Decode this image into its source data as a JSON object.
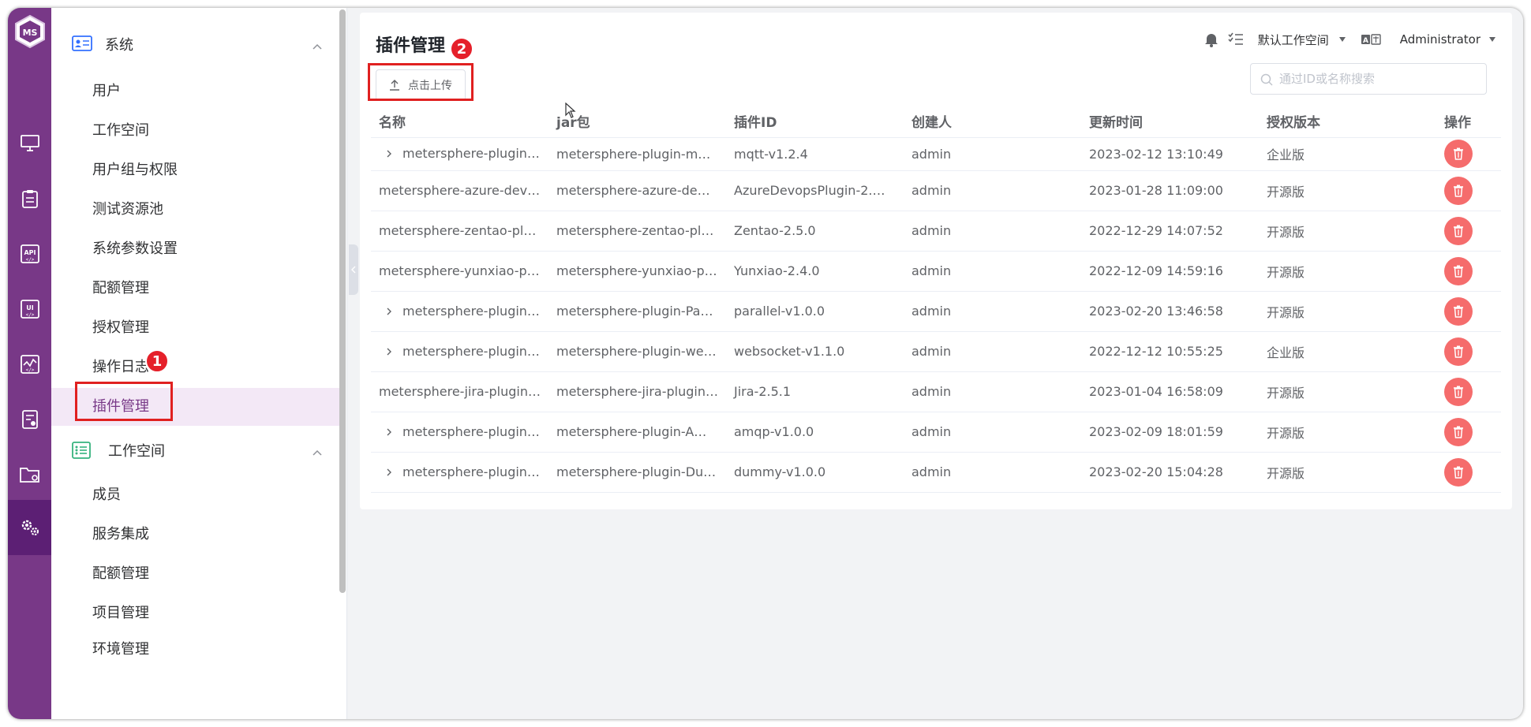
{
  "colors": {
    "brand": "#783887",
    "danger": "#f56c6c",
    "annotation": "#e02020"
  },
  "rail": {
    "logo_text": "MS",
    "items": [
      {
        "name": "workstation",
        "icon": "monitor-icon"
      },
      {
        "name": "track",
        "icon": "clipboard-icon"
      },
      {
        "name": "api",
        "icon": "api-icon",
        "label": "API"
      },
      {
        "name": "ui",
        "icon": "ui-icon",
        "label": "UI"
      },
      {
        "name": "performance",
        "icon": "chart-icon"
      },
      {
        "name": "report",
        "icon": "report-icon"
      },
      {
        "name": "project",
        "icon": "folder-icon"
      },
      {
        "name": "settings",
        "icon": "gear-icon",
        "active": true
      }
    ]
  },
  "subnav": {
    "system": {
      "label": "系统",
      "items": [
        "用户",
        "工作空间",
        "用户组与权限",
        "测试资源池",
        "系统参数设置",
        "配额管理",
        "授权管理",
        "操作日志",
        "插件管理"
      ]
    },
    "workspace": {
      "label": "工作空间",
      "items": [
        "成员",
        "服务集成",
        "配额管理",
        "项目管理",
        "环境管理"
      ]
    }
  },
  "header": {
    "title": "插件管理",
    "workspace": "默认工作空间",
    "user": "Administrator",
    "lang_icon": "translate-icon"
  },
  "toolbar": {
    "upload_label": "点击上传",
    "search_placeholder": "通过ID或名称搜索"
  },
  "table": {
    "columns": [
      "名称",
      "jar包",
      "插件ID",
      "创建人",
      "更新时间",
      "授权版本",
      "操作"
    ],
    "rows": [
      {
        "expand": true,
        "name": "metersphere-plugin…",
        "jar": "metersphere-plugin-m…",
        "id": "mqtt-v1.2.4",
        "creator": "admin",
        "updated": "2023-02-12 13:10:49",
        "edition": "企业版"
      },
      {
        "expand": false,
        "name": "metersphere-azure-dev…",
        "jar": "metersphere-azure-de…",
        "id": "AzureDevopsPlugin-2.…",
        "creator": "admin",
        "updated": "2023-01-28 11:09:00",
        "edition": "开源版"
      },
      {
        "expand": false,
        "name": "metersphere-zentao-pl…",
        "jar": "metersphere-zentao-pl…",
        "id": "Zentao-2.5.0",
        "creator": "admin",
        "updated": "2022-12-29 14:07:52",
        "edition": "开源版"
      },
      {
        "expand": false,
        "name": "metersphere-yunxiao-p…",
        "jar": "metersphere-yunxiao-p…",
        "id": "Yunxiao-2.4.0",
        "creator": "admin",
        "updated": "2022-12-09 14:59:16",
        "edition": "开源版"
      },
      {
        "expand": true,
        "name": "metersphere-plugin…",
        "jar": "metersphere-plugin-Pa…",
        "id": "parallel-v1.0.0",
        "creator": "admin",
        "updated": "2023-02-20 13:46:58",
        "edition": "开源版"
      },
      {
        "expand": true,
        "name": "metersphere-plugin…",
        "jar": "metersphere-plugin-we…",
        "id": "websocket-v1.1.0",
        "creator": "admin",
        "updated": "2022-12-12 10:55:25",
        "edition": "企业版"
      },
      {
        "expand": false,
        "name": "metersphere-jira-plugin…",
        "jar": "metersphere-jira-plugin…",
        "id": "Jira-2.5.1",
        "creator": "admin",
        "updated": "2023-01-04 16:58:09",
        "edition": "开源版"
      },
      {
        "expand": true,
        "name": "metersphere-plugin…",
        "jar": "metersphere-plugin-A…",
        "id": "amqp-v1.0.0",
        "creator": "admin",
        "updated": "2023-02-09 18:01:59",
        "edition": "开源版"
      },
      {
        "expand": true,
        "name": "metersphere-plugin…",
        "jar": "metersphere-plugin-Du…",
        "id": "dummy-v1.0.0",
        "creator": "admin",
        "updated": "2023-02-20 15:04:28",
        "edition": "开源版"
      }
    ]
  },
  "annotations": {
    "badge1": "1",
    "badge2": "2"
  }
}
